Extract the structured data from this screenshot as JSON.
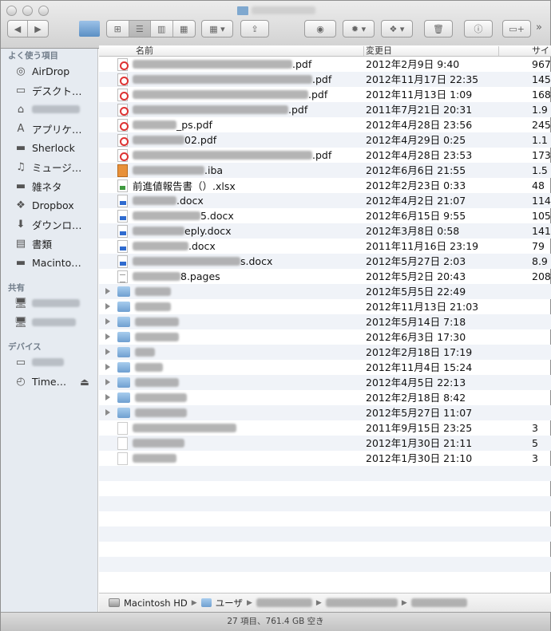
{
  "window": {
    "title": "",
    "status": "27 項目、761.4 GB 空き"
  },
  "toolbar": {
    "more_label": "»"
  },
  "sidebar": {
    "favorites_header": "よく使う項目",
    "favorites": [
      {
        "label": "AirDrop",
        "icon": "airdrop-icon"
      },
      {
        "label": "デスクト…",
        "icon": "desktop-icon"
      },
      {
        "label": "",
        "icon": "home-icon"
      },
      {
        "label": "アプリケ…",
        "icon": "applications-icon"
      },
      {
        "label": "Sherlock",
        "icon": "folder-icon"
      },
      {
        "label": "ミュージ…",
        "icon": "music-icon"
      },
      {
        "label": "雑ネタ",
        "icon": "folder-icon"
      },
      {
        "label": "Dropbox",
        "icon": "dropbox-icon"
      },
      {
        "label": "ダウンロ…",
        "icon": "downloads-icon"
      },
      {
        "label": "書類",
        "icon": "documents-icon"
      },
      {
        "label": "Macinto…",
        "icon": "folder-icon"
      }
    ],
    "shared_header": "共有",
    "devices_header": "デバイス",
    "devices": [
      {
        "label": "",
        "icon": "disk-icon"
      },
      {
        "label": "Time…",
        "icon": "timemachine-icon"
      }
    ]
  },
  "columns": {
    "name": "名前",
    "date": "変更日",
    "size": "サイ"
  },
  "files": [
    {
      "name": ".pdf",
      "type": "pdf",
      "date": "2012年2月9日 9:40",
      "size": "967",
      "blur": 200
    },
    {
      "name": ".pdf",
      "type": "pdf",
      "date": "2012年11月17日 22:35",
      "size": "145",
      "blur": 225
    },
    {
      "name": ".pdf",
      "type": "pdf",
      "date": "2012年11月13日 1:09",
      "size": "168",
      "blur": 220
    },
    {
      "name": ".pdf",
      "type": "pdf",
      "date": "2011年7月21日 20:31",
      "size": "1.9",
      "blur": 195
    },
    {
      "name": "_ps.pdf",
      "type": "pdf",
      "date": "2012年4月28日 23:56",
      "size": "245",
      "blur": 55
    },
    {
      "name": "02.pdf",
      "type": "pdf",
      "date": "2012年4月29日 0:25",
      "size": "1.1",
      "blur": 65
    },
    {
      "name": ".pdf",
      "type": "pdf",
      "date": "2012年4月28日 23:53",
      "size": "173",
      "blur": 225
    },
    {
      "name": ".iba",
      "type": "iba",
      "date": "2012年6月6日 21:55",
      "size": "1.5",
      "blur": 90
    },
    {
      "name": "前進値報告書（）.xlsx",
      "type": "xlsx",
      "date": "2012年2月23日 0:33",
      "size": "48",
      "blur": 0
    },
    {
      "name": ".docx",
      "type": "docx",
      "date": "2012年4月2日 21:07",
      "size": "114",
      "blur": 55
    },
    {
      "name": "5.docx",
      "type": "docx",
      "date": "2012年6月15日 9:55",
      "size": "105",
      "blur": 85
    },
    {
      "name": "eply.docx",
      "type": "docx",
      "date": "2012年3月8日 0:58",
      "size": "141",
      "blur": 65
    },
    {
      "name": ".docx",
      "type": "docx",
      "date": "2011年11月16日 23:19",
      "size": "79",
      "blur": 70
    },
    {
      "name": "s.docx",
      "type": "docx",
      "date": "2012年5月27日 2:03",
      "size": "8.9",
      "blur": 135
    },
    {
      "name": "8.pages",
      "type": "pages",
      "date": "2012年5月2日 20:43",
      "size": "208",
      "blur": 60
    },
    {
      "name": "",
      "type": "folder",
      "date": "2012年5月5日 22:49",
      "size": "",
      "blur": 45
    },
    {
      "name": "",
      "type": "folder",
      "date": "2012年11月13日 21:03",
      "size": "",
      "blur": 45
    },
    {
      "name": "",
      "type": "folder",
      "date": "2012年5月14日 7:18",
      "size": "",
      "blur": 55
    },
    {
      "name": "",
      "type": "folder",
      "date": "2012年6月3日 17:30",
      "size": "",
      "blur": 55
    },
    {
      "name": "",
      "type": "folder",
      "date": "2012年2月18日 17:19",
      "size": "",
      "blur": 25
    },
    {
      "name": "",
      "type": "folder",
      "date": "2012年11月4日 15:24",
      "size": "",
      "blur": 35
    },
    {
      "name": "",
      "type": "folder",
      "date": "2012年4月5日 22:13",
      "size": "",
      "blur": 55
    },
    {
      "name": "",
      "type": "folder",
      "date": "2012年2月18日 8:42",
      "size": "",
      "blur": 65
    },
    {
      "name": "",
      "type": "folder",
      "date": "2012年5月27日 11:07",
      "size": "",
      "blur": 65
    },
    {
      "name": "",
      "type": "gen",
      "date": "2011年9月15日 23:25",
      "size": "3",
      "blur": 130
    },
    {
      "name": "",
      "type": "gen",
      "date": "2012年1月30日 21:11",
      "size": "5",
      "blur": 65
    },
    {
      "name": "",
      "type": "gen",
      "date": "2012年1月30日 21:10",
      "size": "3",
      "blur": 55
    }
  ],
  "path": {
    "items": [
      "Macintosh HD",
      "ユーザ"
    ]
  }
}
